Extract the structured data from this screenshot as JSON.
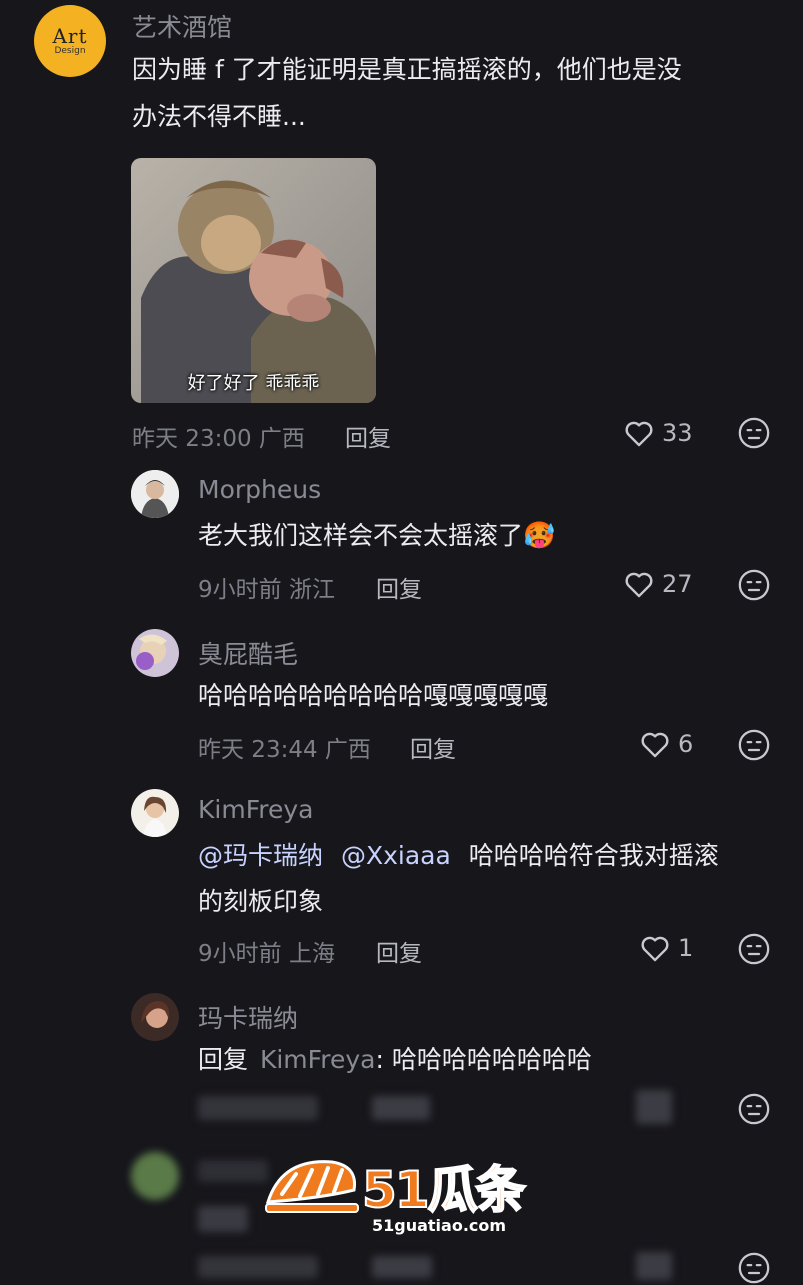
{
  "comments": [
    {
      "user": "艺术酒馆",
      "avatar": {
        "line1": "Art",
        "line2": "Design"
      },
      "text_line1": "因为睡 f 了才能证明是真正搞摇滚的，他们也是没",
      "text_line2": "办法不得不睡...",
      "image_caption": "好了好了  乖乖乖",
      "time": "昨天 23:00 广西",
      "reply": "回复",
      "likes": "33"
    },
    {
      "user": "Morpheus",
      "text": "老大我们这样会不会太摇滚了",
      "emoji": "🥵",
      "time": "9小时前 浙江",
      "reply": "回复",
      "likes": "27"
    },
    {
      "user": "臭屁酷毛",
      "text": "哈哈哈哈哈哈哈哈哈嘎嘎嘎嘎嘎",
      "time": "昨天 23:44 广西",
      "reply": "回复",
      "likes": "6"
    },
    {
      "user": "KimFreya",
      "mention1": "@玛卡瑞纳",
      "mention2": "@Xxiaaa",
      "text_line1_rest": "哈哈哈哈符合我对摇滚",
      "text_line2": "的刻板印象",
      "time": "9小时前 上海",
      "reply": "回复",
      "likes": "1"
    },
    {
      "user": "玛卡瑞纳",
      "reply_prefix": "回复",
      "reply_to": "KimFreya",
      "text": ": 哈哈哈哈哈哈哈哈"
    }
  ],
  "watermark": {
    "brand": "51瓜条",
    "url": "51guatiao.com"
  },
  "colors": {
    "background": "#16161b",
    "avatar_brand": "#f4b122",
    "watermark": "#f07a1e"
  }
}
